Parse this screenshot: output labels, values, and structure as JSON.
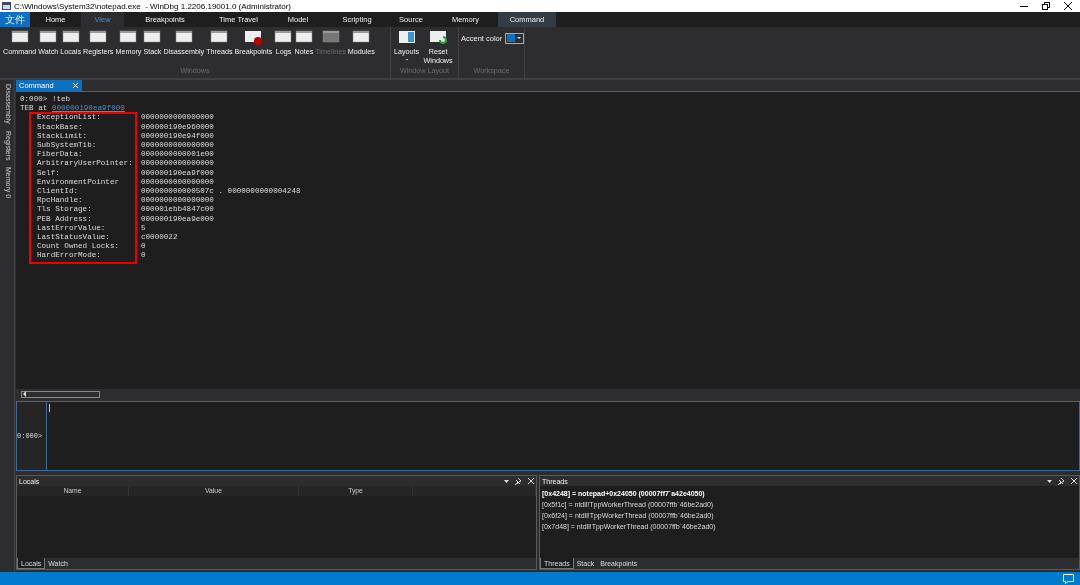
{
  "window": {
    "title": "C:\\Windows\\System32\\notepad.exe  - WinDbg 1.2206.19001.0 (Administrator)"
  },
  "menu_tabs": [
    {
      "label": "文件",
      "kind": "file",
      "selected": false
    },
    {
      "label": "Home",
      "kind": "tab",
      "selected": false
    },
    {
      "label": "View",
      "kind": "tab",
      "selected": true
    },
    {
      "label": "Breakpoints",
      "kind": "tab",
      "selected": false
    },
    {
      "label": "Time Travel",
      "kind": "tab",
      "selected": false
    },
    {
      "label": "Model",
      "kind": "tab",
      "selected": false
    },
    {
      "label": "Scripting",
      "kind": "tab",
      "selected": false
    },
    {
      "label": "Source",
      "kind": "tab",
      "selected": false
    },
    {
      "label": "Memory",
      "kind": "tab",
      "selected": false
    },
    {
      "label": "Command",
      "kind": "context",
      "selected": false
    }
  ],
  "ribbon_groups": [
    {
      "name": "Windows",
      "buttons": [
        {
          "label": "Command",
          "kind": "window",
          "disabled": false
        },
        {
          "label": "Watch",
          "kind": "window",
          "disabled": false
        },
        {
          "label": "Locals",
          "kind": "window",
          "disabled": false
        },
        {
          "label": "Registers",
          "kind": "window",
          "disabled": false
        },
        {
          "label": "Memory",
          "kind": "window",
          "disabled": false
        },
        {
          "label": "Stack",
          "kind": "window",
          "disabled": false
        },
        {
          "label": "Disassembly",
          "kind": "window",
          "disabled": false
        },
        {
          "label": "Threads",
          "kind": "window",
          "disabled": false
        },
        {
          "label": "Breakpoints",
          "kind": "breakpoint",
          "disabled": false
        },
        {
          "label": "Logs",
          "kind": "window",
          "disabled": false
        },
        {
          "label": "Notes",
          "kind": "window",
          "disabled": false
        },
        {
          "label": "Timelines",
          "kind": "window",
          "disabled": true
        },
        {
          "label": "Modules",
          "kind": "window",
          "disabled": false
        }
      ]
    },
    {
      "name": "Window Layout",
      "buttons": [
        {
          "label": "Layouts",
          "kind": "layout",
          "disabled": false
        },
        {
          "label": "Reset Windows",
          "kind": "reset",
          "disabled": false
        }
      ]
    },
    {
      "name": "Workspace",
      "accent_label": "Accent color"
    }
  ],
  "sidebar": {
    "items": [
      {
        "label": "Disassembly"
      },
      {
        "label": "Registers"
      },
      {
        "label": "Memory 0"
      }
    ]
  },
  "command": {
    "tab": "Command",
    "lines": [
      "0:000> !teb"
    ],
    "teb_prefix": "TEB at ",
    "teb_address": "000000190ea9f000",
    "highlighted": true,
    "fields": [
      {
        "label": "ExceptionList:",
        "value": "0000000000000000"
      },
      {
        "label": "StackBase:",
        "value": "000000190e960000"
      },
      {
        "label": "StackLimit:",
        "value": "000000190e94f000"
      },
      {
        "label": "SubSystemTib:",
        "value": "0000000000000000"
      },
      {
        "label": "FiberData:",
        "value": "0000000000001e00"
      },
      {
        "label": "ArbitraryUserPointer:",
        "value": "0000000000000000"
      },
      {
        "label": "Self:",
        "value": "000000190ea9f000"
      },
      {
        "label": "EnvironmentPointer",
        "value": "0000000000000000"
      },
      {
        "label": "ClientId:",
        "value": "000000000000507c . 0000000000004248"
      },
      {
        "label": "RpcHandle:",
        "value": "0000000000000000"
      },
      {
        "label": "Tls Storage:",
        "value": "000001ebb4847c00"
      },
      {
        "label": "PEB Address:",
        "value": "000000190ea9e000"
      },
      {
        "label": "LastErrorValue:",
        "value": "5"
      },
      {
        "label": "LastStatusValue:",
        "value": "c0000022"
      },
      {
        "label": "Count Owned Locks:",
        "value": "0"
      },
      {
        "label": "HardErrorMode:",
        "value": "0"
      }
    ],
    "prompt": "0:000>"
  },
  "locals": {
    "title": "Locals",
    "columns": [
      "Name",
      "Value",
      "Type"
    ],
    "tabs": [
      {
        "label": "Locals",
        "selected": true
      },
      {
        "label": "Watch",
        "selected": false
      }
    ]
  },
  "threads": {
    "title": "Threads",
    "rows": [
      {
        "text": "[0x4248] = notepad+0x24050 (00007ff7`a42e4050)",
        "current": true
      },
      {
        "text": "[0x5f1c] = ntdll!TppWorkerThread (00007ffb`46be2ad0)",
        "current": false
      },
      {
        "text": "[0x6f24] = ntdll!TppWorkerThread (00007ffb`46be2ad0)",
        "current": false
      },
      {
        "text": "[0x7d48] = ntdll!TppWorkerThread (00007ffb`46be2ad0)",
        "current": false
      }
    ],
    "tabs": [
      {
        "label": "Threads",
        "selected": true
      },
      {
        "label": "Stack",
        "selected": false
      },
      {
        "label": "Breakpoints",
        "selected": false
      }
    ]
  }
}
